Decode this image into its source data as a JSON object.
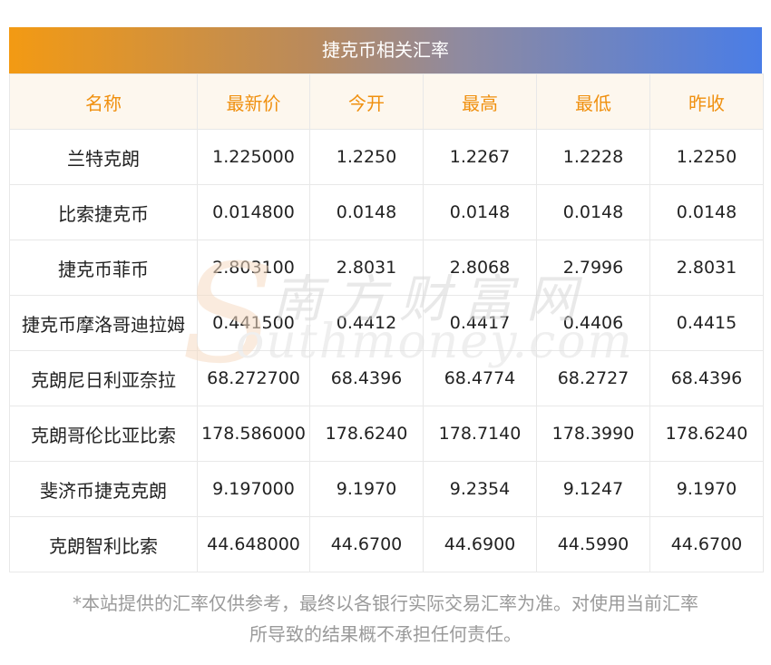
{
  "title": "捷克币相关汇率",
  "columns": [
    "名称",
    "最新价",
    "今开",
    "最高",
    "最低",
    "昨收"
  ],
  "rows": [
    [
      "兰特克朗",
      "1.225000",
      "1.2250",
      "1.2267",
      "1.2228",
      "1.2250"
    ],
    [
      "比索捷克币",
      "0.014800",
      "0.0148",
      "0.0148",
      "0.0148",
      "0.0148"
    ],
    [
      "捷克币菲币",
      "2.803100",
      "2.8031",
      "2.8068",
      "2.7996",
      "2.8031"
    ],
    [
      "捷克币摩洛哥迪拉姆",
      "0.441500",
      "0.4412",
      "0.4417",
      "0.4406",
      "0.4415"
    ],
    [
      "克朗尼日利亚奈拉",
      "68.272700",
      "68.4396",
      "68.4774",
      "68.2727",
      "68.4396"
    ],
    [
      "克朗哥伦比亚比索",
      "178.586000",
      "178.6240",
      "178.7140",
      "178.3990",
      "178.6240"
    ],
    [
      "斐济币捷克克朗",
      "9.197000",
      "9.1970",
      "9.2354",
      "9.1247",
      "9.1970"
    ],
    [
      "克朗智利比索",
      "44.648000",
      "44.6700",
      "44.6900",
      "44.5990",
      "44.6700"
    ]
  ],
  "watermark": {
    "cn": "南方财富网",
    "en": "outhmoney.com",
    "s": "S"
  },
  "footnote": {
    "line1": "*本站提供的汇率仅供参考，最终以各银行实际交易汇率为准。对使用当前汇率",
    "line2": "所导致的结果概不承担任何责任。"
  },
  "colors": {
    "header_text": "#f0900f",
    "header_bg": "#fdf7ee",
    "gradient_start": "#f39a13",
    "gradient_end": "#4a7de6"
  }
}
